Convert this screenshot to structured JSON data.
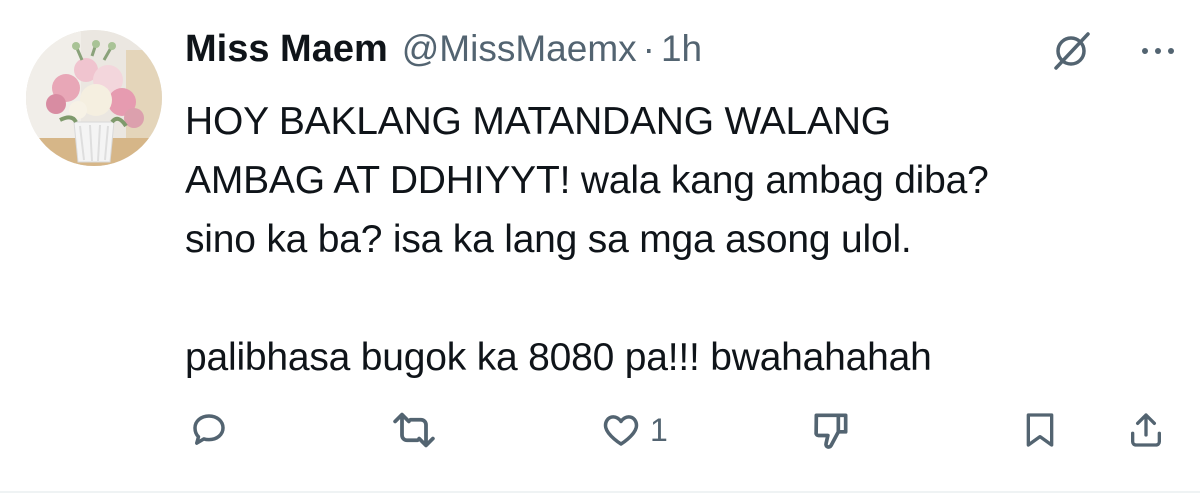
{
  "tweet": {
    "author": {
      "name": "Miss Maem",
      "handle": "@MissMaemx",
      "separator": "·",
      "time": "1h"
    },
    "text_lines": [
      "HOY BAKLANG MATANDANG WALANG",
      "AMBAG AT DDHIYYT! wala kang ambag diba?",
      "sino ka ba? isa ka lang sa mga asong ulol.",
      "",
      "palibhasa bugok ka 8080 pa!!! bwahahahah"
    ],
    "actions": {
      "like_count": "1"
    },
    "icons": {
      "avatar": "flower-vase-avatar",
      "grok": "grok-icon",
      "more": "more-icon",
      "reply": "reply-icon",
      "retweet": "retweet-icon",
      "like": "heart-icon",
      "dislike": "downvote-icon",
      "bookmark": "bookmark-icon",
      "share": "share-icon"
    },
    "colors": {
      "text": "#0f1419",
      "secondary": "#536471",
      "background": "#ffffff",
      "divider": "#eff3f4"
    }
  }
}
